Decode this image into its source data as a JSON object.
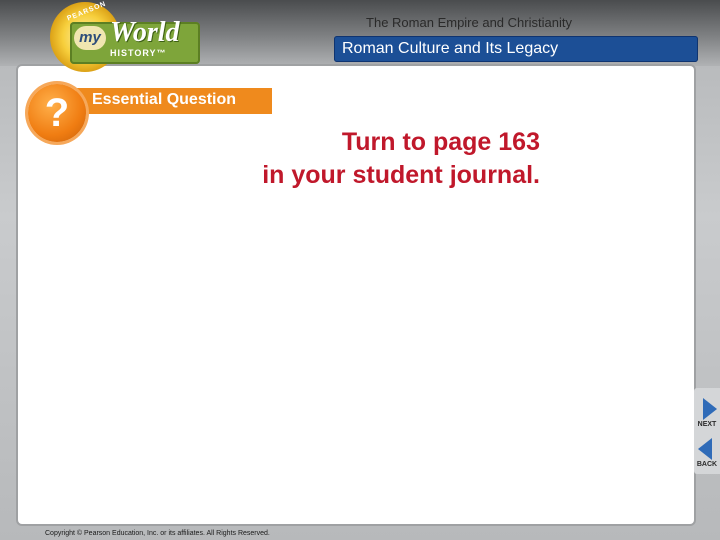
{
  "logo": {
    "publisher": "PEARSON",
    "my": "my",
    "world": "World",
    "history": "HISTORY™"
  },
  "header": {
    "title": "The Roman Empire and Christianity",
    "subtitle": "Roman Culture and Its Legacy"
  },
  "essential_question": {
    "icon": "?",
    "label": "Essential Question"
  },
  "main": {
    "line1": "Turn to page 163",
    "line2": "in your student journal."
  },
  "nav": {
    "next_label": "NEXT",
    "back_label": "BACK"
  },
  "footer": {
    "copyright": "Copyright © Pearson Education, Inc. or its affiliates. All Rights Reserved."
  },
  "colors": {
    "accent_orange": "#ef8a1d",
    "header_blue": "#1c4f96",
    "text_red": "#c0182b",
    "nav_blue": "#2f6bb8"
  }
}
